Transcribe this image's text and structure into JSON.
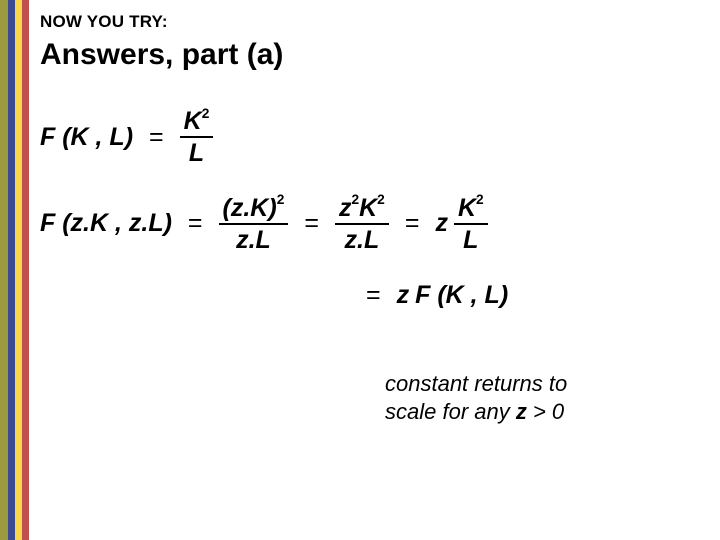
{
  "header": {
    "kicker": "NOW YOU TRY:",
    "title": "Answers, part (a)"
  },
  "eq1": {
    "lhs": "F (K , L)",
    "eq": "=",
    "num": "K",
    "num_exp": "2",
    "den": "L"
  },
  "eq2": {
    "lhs": "F (z.K , z.L)",
    "eq": "=",
    "f1_num_a": "(z.K)",
    "f1_num_exp": "2",
    "f1_den": "z.L",
    "eq2": "=",
    "f2_num_a": "z",
    "f2_num_exp1": "2",
    "f2_num_b": "K",
    "f2_num_exp2": "2",
    "f2_den": "z.L",
    "eq3": "=",
    "zcoef": "z",
    "f3_num": "K",
    "f3_num_exp": "2",
    "f3_den": "L"
  },
  "eq3": {
    "eq": "=",
    "zcoef": "z",
    "fk": "F (K , L)"
  },
  "conclusion": {
    "line1": "constant returns to",
    "line2a": "scale for any ",
    "zvar": "z",
    "line2b": " > 0"
  }
}
